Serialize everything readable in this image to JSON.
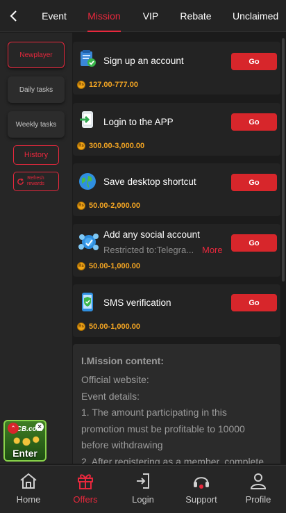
{
  "header": {
    "tabs": [
      {
        "label": "Event"
      },
      {
        "label": "Mission"
      },
      {
        "label": "VIP"
      },
      {
        "label": "Rebate"
      },
      {
        "label": "Unclaimed"
      }
    ],
    "active_tab": "Mission"
  },
  "sidebar": {
    "items": [
      {
        "label": "Newplayer"
      },
      {
        "label": "Daily tasks"
      },
      {
        "label": "Weekly tasks"
      }
    ],
    "history_label": "History",
    "refresh_label_1": "Refresh",
    "refresh_label_2": "rewards"
  },
  "tasks": [
    {
      "title": "Sign up an account",
      "reward": "127.00-777.00",
      "button": "Go",
      "icon": "clipboard-check-icon"
    },
    {
      "title": "Login to the APP",
      "reward": "300.00-3,000.00",
      "button": "Go",
      "icon": "phone-login-icon"
    },
    {
      "title": "Save desktop shortcut",
      "reward": "50.00-2,000.00",
      "button": "Go",
      "icon": "globe-icon"
    },
    {
      "title": "Add any social account",
      "subtitle": "Restricted to:Telegra...",
      "more": "More",
      "reward": "50.00-1,000.00",
      "button": "Go",
      "icon": "social-network-icon"
    },
    {
      "title": "SMS verification",
      "reward": "50.00-1,000.00",
      "button": "Go",
      "icon": "phone-shield-icon"
    }
  ],
  "coin_symbol": "Rs",
  "mission_content": {
    "heading": "I.Mission content:",
    "lines": [
      "Official website:",
      "Event details:",
      "1. The amount participating in this",
      "promotion must be profitable to 10000",
      "before withdrawing",
      "2. After registering as a member, complete"
    ]
  },
  "floating": {
    "logo": "ICB.com",
    "label": "Enter"
  },
  "bottom_nav": [
    {
      "label": "Home",
      "icon": "home-icon"
    },
    {
      "label": "Offers",
      "icon": "gift-icon"
    },
    {
      "label": "Login",
      "icon": "login-icon"
    },
    {
      "label": "Support",
      "icon": "headset-icon"
    },
    {
      "label": "Profile",
      "icon": "user-icon"
    }
  ],
  "colors": {
    "accent": "#e8283d",
    "button": "#d7262b",
    "reward": "#f5a623",
    "background": "#1b1b1b"
  }
}
